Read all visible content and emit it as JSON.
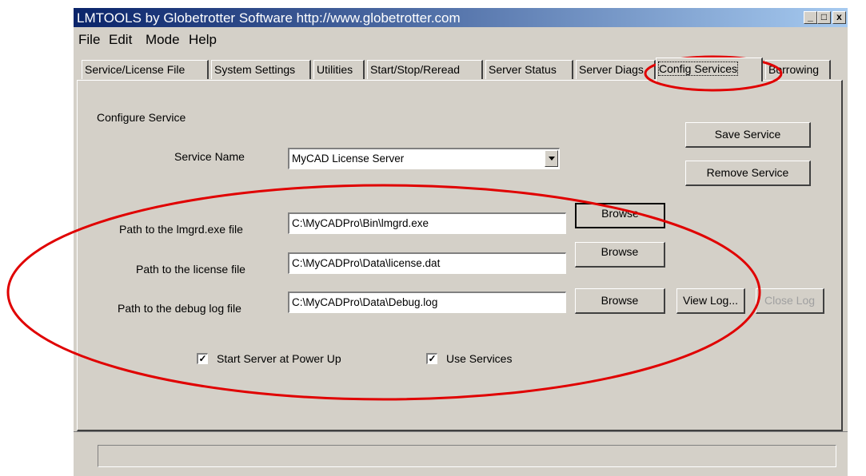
{
  "window": {
    "title": "LMTOOLS by Globetrotter Software http://www.globetrotter.com",
    "minimize": "_",
    "maximize": "□",
    "close": "x"
  },
  "menu": [
    "File",
    "Edit",
    "Mode",
    "Help"
  ],
  "tabs": [
    {
      "label": "Service/License File"
    },
    {
      "label": "System Settings"
    },
    {
      "label": "Utilities"
    },
    {
      "label": "Start/Stop/Reread"
    },
    {
      "label": "Server Status"
    },
    {
      "label": "Server Diags"
    },
    {
      "label": "Config Services",
      "active": true
    },
    {
      "label": "Borrowing"
    }
  ],
  "config": {
    "section_label": "Configure Service",
    "service_name_label": "Service Name",
    "service_name_value": "MyCAD License Server",
    "save_service": "Save Service",
    "remove_service": "Remove Service",
    "lmgrd_label": "Path to the lmgrd.exe file",
    "lmgrd_value": "C:\\MyCADPro\\Bin\\lmgrd.exe",
    "license_label": "Path to the license file",
    "license_value": "C:\\MyCADPro\\Data\\license.dat",
    "debug_label": "Path to the debug log file",
    "debug_value": "C:\\MyCADPro\\Data\\Debug.log",
    "browse": "Browse",
    "view_log": "View Log...",
    "close_log": "Close Log",
    "start_at_power_up": {
      "label": "Start Server at Power Up",
      "checked": true
    },
    "use_services": {
      "label": "Use Services",
      "checked": true
    }
  },
  "annotation_color": "#e00000"
}
